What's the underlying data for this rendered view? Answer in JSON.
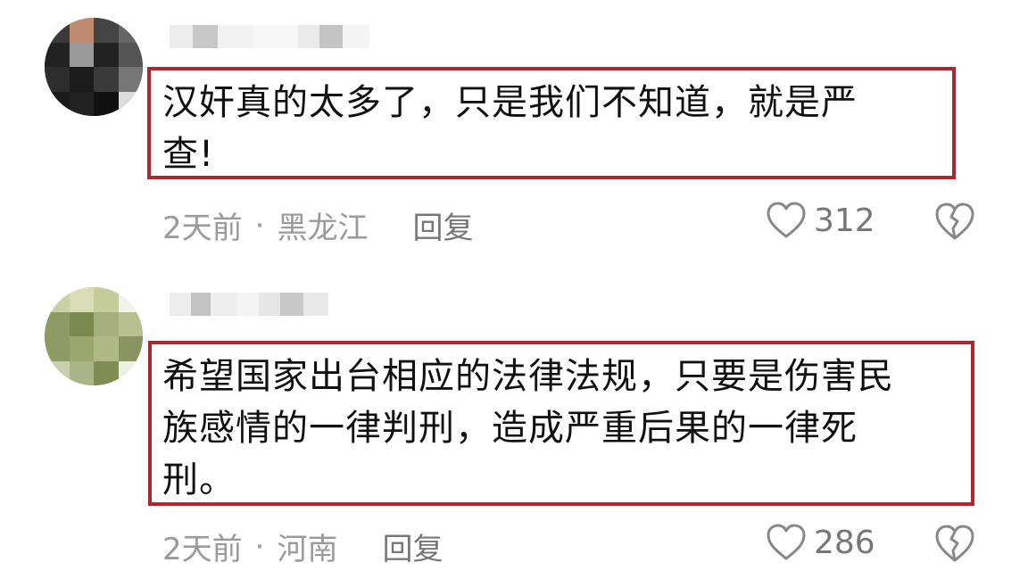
{
  "comments": [
    {
      "text": "汉奸真的太多了，只是我们不知道，就是严\n查!",
      "time": "2天前",
      "separator": "·",
      "location": "黑龙江",
      "reply_label": "回复",
      "likes": "312"
    },
    {
      "text": "希望国家出台相应的法律法规，只要是伤害民\n族感情的一律判刑，造成严重后果的一律死\n刑。",
      "time": "2天前",
      "separator": "·",
      "location": "河南",
      "reply_label": "回复",
      "likes": "286"
    }
  ],
  "colors": {
    "highlight_border": "#b0262c",
    "meta_text": "#9a9a9a",
    "icon_stroke": "#888888"
  },
  "icons": {
    "like": "heart-outline-icon",
    "dislike": "broken-heart-icon"
  }
}
